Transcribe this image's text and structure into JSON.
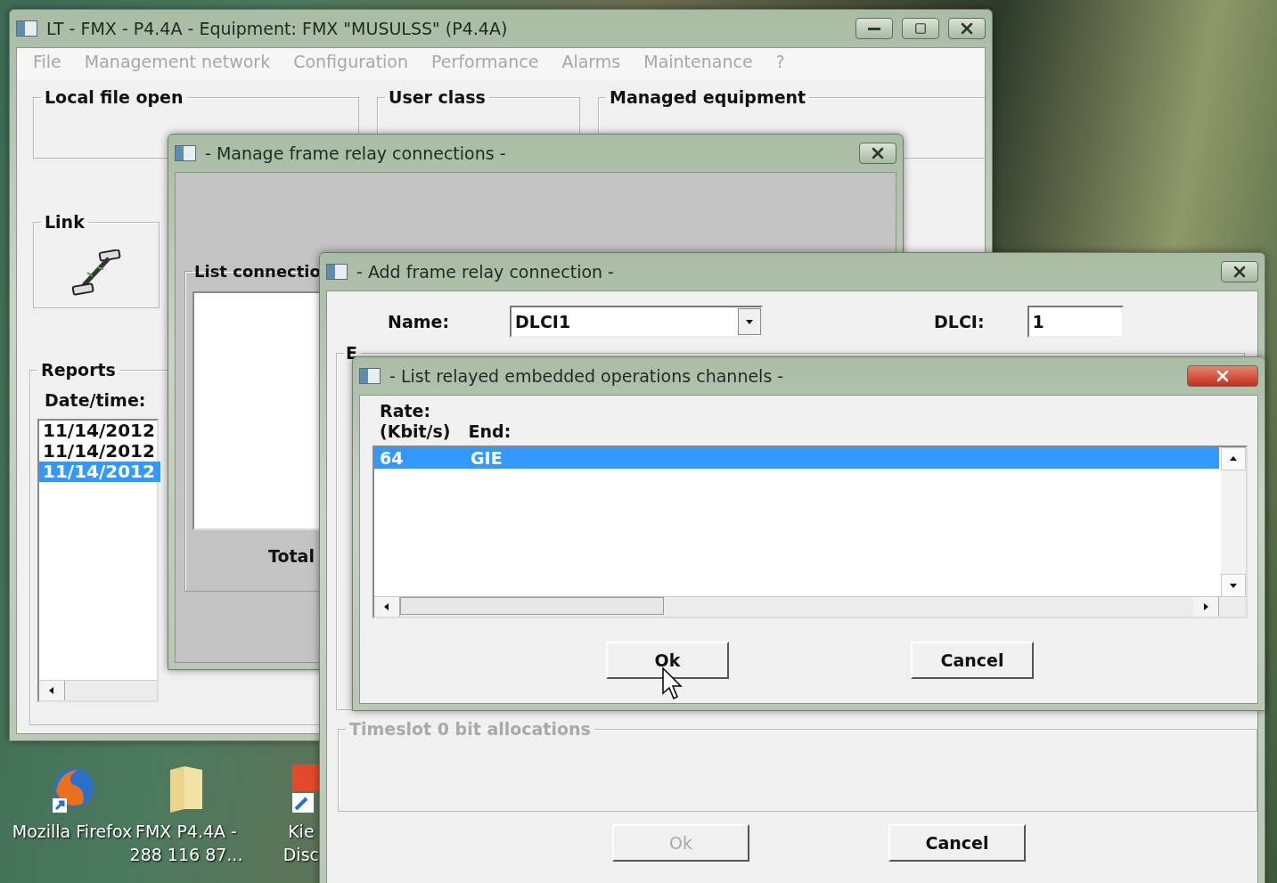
{
  "desktop": {
    "icons": [
      {
        "kind": "browser",
        "lines": [
          "Mozilla Firefox"
        ]
      },
      {
        "kind": "folder",
        "lines": [
          "FMX P4.4A -",
          "288 116 87..."
        ]
      },
      {
        "kind": "app",
        "lines": [
          "Kie",
          "Disc"
        ]
      }
    ]
  },
  "main_window": {
    "title": "LT - FMX - P4.4A - Equipment: FMX \"MUSULSS\" (P4.4A)",
    "active": false,
    "menu": [
      "File",
      "Management network",
      "Configuration",
      "Performance",
      "Alarms",
      "Maintenance",
      "?"
    ],
    "groups": [
      "Local file open",
      "User class",
      "Managed equipment"
    ],
    "link_label": "Link",
    "reports": {
      "title": "Reports",
      "column": "Date/time:",
      "rows": [
        {
          "text": "11/14/2012",
          "selected": false
        },
        {
          "text": "11/14/2012",
          "selected": false
        },
        {
          "text": "11/14/2012",
          "selected": true
        }
      ]
    }
  },
  "manage_dialog": {
    "title": "- Manage frame relay connections -",
    "active": false,
    "list_label": "List connectio",
    "total_label": "Total"
  },
  "add_dialog": {
    "title": "- Add frame relay connection -",
    "active": false,
    "name_label": "Name:",
    "name_value": "DLCI1",
    "dlci_label": "DLCI:",
    "dlci_value": "1",
    "group_label": "E",
    "timeslot_label": "Timeslot 0 bit allocations",
    "buttons": [
      {
        "label": "Ok",
        "disabled": true
      },
      {
        "label": "Cancel",
        "disabled": false
      }
    ]
  },
  "list_dialog": {
    "title": "- List relayed embedded operations channels -",
    "active": true,
    "rate_header": [
      "Rate:",
      "(Kbit/s)"
    ],
    "end_header": "End:",
    "rows": [
      {
        "cells": [
          "64",
          "GIE"
        ],
        "selected": true
      }
    ],
    "buttons": [
      {
        "label": "Ok",
        "disabled": false
      },
      {
        "label": "Cancel",
        "disabled": false
      }
    ]
  }
}
